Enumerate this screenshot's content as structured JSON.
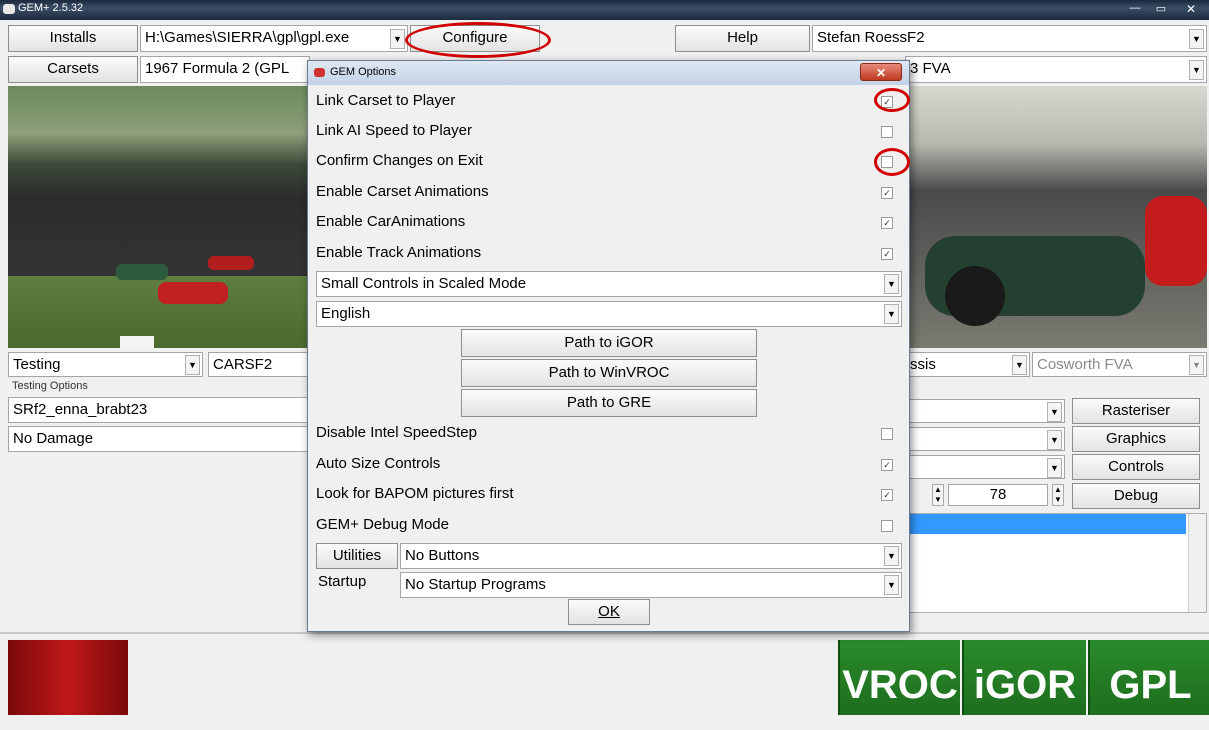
{
  "app": {
    "title": "GEM+ 2.5.32"
  },
  "toolbar": {
    "installs": "Installs",
    "install_path": "H:\\Games\\SIERRA\\gpl\\gpl.exe",
    "configure": "Configure",
    "help": "Help",
    "player": "Stefan RoessF2",
    "carsets": "Carsets",
    "carset_value": "1967 Formula 2 (GPL",
    "engine_partial": "3 FVA"
  },
  "mode": {
    "testing": "Testing",
    "carsf2": "CARSF2",
    "chassis_partial": "ssis",
    "engine": "Cosworth FVA",
    "testing_options": "Testing Options",
    "track": "SRf2_enna_brabt23",
    "damage": "No Damage"
  },
  "side_buttons": {
    "rasteriser": "Rasteriser",
    "graphics": "Graphics",
    "controls": "Controls",
    "debug": "Debug",
    "number": "78"
  },
  "dialog": {
    "title": "GEM Options",
    "options": [
      {
        "label": "Link Carset to Player",
        "checked": true
      },
      {
        "label": "Link AI Speed to Player",
        "checked": false
      },
      {
        "label": "Confirm Changes on Exit",
        "checked": false
      },
      {
        "label": "Enable Carset Animations",
        "checked": true
      },
      {
        "label": "Enable CarAnimations",
        "checked": true
      },
      {
        "label": "Enable Track Animations",
        "checked": true
      }
    ],
    "scaled_mode": "Small Controls in Scaled Mode",
    "language": "English",
    "path_igor": "Path to iGOR",
    "path_winvroc": "Path to WinVROC",
    "path_gre": "Path to GRE",
    "options2": [
      {
        "label": "Disable Intel SpeedStep",
        "checked": false
      },
      {
        "label": "Auto Size Controls",
        "checked": true
      },
      {
        "label": "Look for BAPOM pictures first",
        "checked": true
      },
      {
        "label": "GEM+ Debug Mode",
        "checked": false
      }
    ],
    "utilities_label": "Utilities",
    "utilities_value": "No Buttons",
    "startup_label": "Startup",
    "startup_value": "No Startup Programs",
    "ok": "OK"
  },
  "logos": {
    "vroc": "VROC",
    "igor": "iGOR",
    "gpl": "GPL"
  },
  "colors": {
    "logo_green": "#1e6e1e",
    "highlight_red": "#d20000",
    "selection_blue": "#3399ff"
  }
}
